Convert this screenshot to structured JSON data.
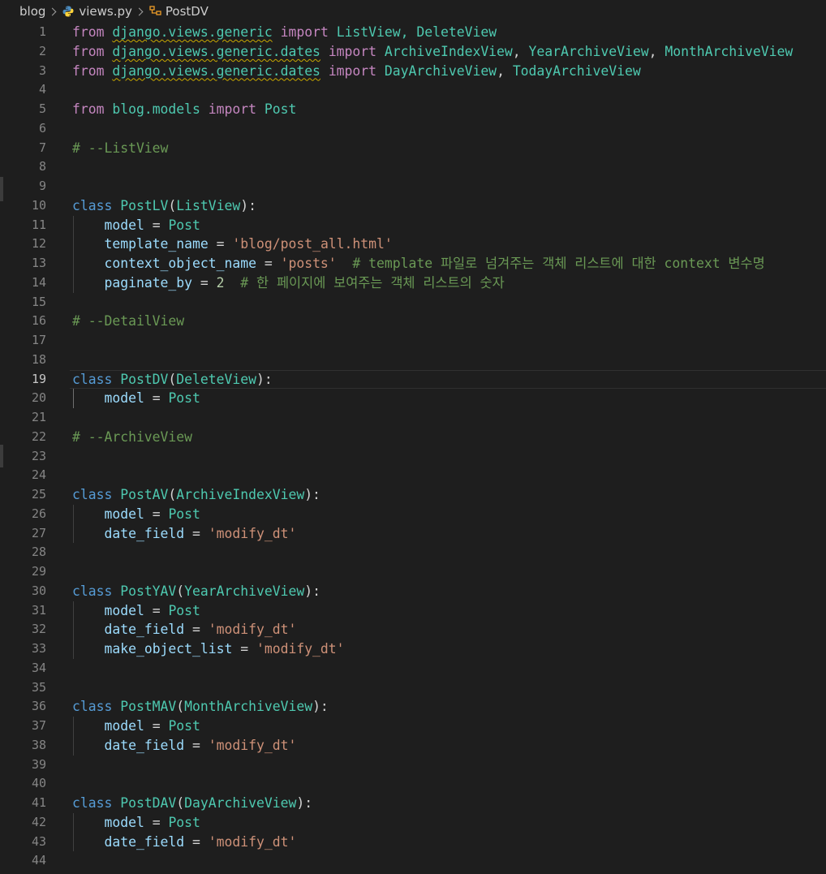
{
  "breadcrumb": {
    "items": [
      {
        "label": "blog",
        "icon": "folder"
      },
      {
        "label": "views.py",
        "icon": "python-icon"
      },
      {
        "label": "PostDV",
        "icon": "class-symbol-icon"
      }
    ]
  },
  "colors": {
    "background": "#1e1e1e",
    "keyword": "#c586c0",
    "storage": "#569cd6",
    "class": "#4ec9b0",
    "variable": "#9cdcfe",
    "string": "#ce9178",
    "number": "#b5cea8",
    "comment": "#6a9955",
    "warning_squiggle": "#c8a800"
  },
  "editor": {
    "current_line": 19,
    "lines": [
      {
        "n": "1",
        "guide": false,
        "tokens": [
          {
            "t": "from",
            "c": "keyword"
          },
          {
            "t": " ",
            "c": "default"
          },
          {
            "t": "django.views.generic",
            "c": "module",
            "w": true
          },
          {
            "t": " ",
            "c": "default"
          },
          {
            "t": "import",
            "c": "keyword"
          },
          {
            "t": " ListView, DeleteView",
            "c": "class"
          }
        ]
      },
      {
        "n": "2",
        "guide": false,
        "tokens": [
          {
            "t": "from",
            "c": "keyword"
          },
          {
            "t": " ",
            "c": "default"
          },
          {
            "t": "django.views.generic.dates",
            "c": "module",
            "w": true
          },
          {
            "t": " ",
            "c": "default"
          },
          {
            "t": "import",
            "c": "keyword"
          },
          {
            "t": " ArchiveIndexView",
            "c": "class"
          },
          {
            "t": ", ",
            "c": "default"
          },
          {
            "t": "YearArchiveView",
            "c": "class"
          },
          {
            "t": ", ",
            "c": "default"
          },
          {
            "t": "MonthArchiveView",
            "c": "class"
          }
        ]
      },
      {
        "n": "3",
        "guide": false,
        "tokens": [
          {
            "t": "from",
            "c": "keyword"
          },
          {
            "t": " ",
            "c": "default"
          },
          {
            "t": "django.views.generic.dates",
            "c": "module",
            "w": true
          },
          {
            "t": " ",
            "c": "default"
          },
          {
            "t": "import",
            "c": "keyword"
          },
          {
            "t": " DayArchiveView",
            "c": "class"
          },
          {
            "t": ", ",
            "c": "default"
          },
          {
            "t": "TodayArchiveView",
            "c": "class"
          }
        ]
      },
      {
        "n": "4",
        "guide": false,
        "tokens": []
      },
      {
        "n": "5",
        "guide": false,
        "tokens": [
          {
            "t": "from",
            "c": "keyword"
          },
          {
            "t": " blog.models ",
            "c": "module"
          },
          {
            "t": "import",
            "c": "keyword"
          },
          {
            "t": " Post",
            "c": "class"
          }
        ]
      },
      {
        "n": "6",
        "guide": false,
        "tokens": []
      },
      {
        "n": "7",
        "guide": false,
        "tokens": [
          {
            "t": "# --ListView",
            "c": "comment"
          }
        ]
      },
      {
        "n": "8",
        "guide": false,
        "tokens": []
      },
      {
        "n": "9",
        "guide": false,
        "tokens": []
      },
      {
        "n": "10",
        "guide": false,
        "tokens": [
          {
            "t": "class",
            "c": "storage"
          },
          {
            "t": " PostLV",
            "c": "class"
          },
          {
            "t": "(",
            "c": "default"
          },
          {
            "t": "ListView",
            "c": "class"
          },
          {
            "t": "):",
            "c": "default"
          }
        ]
      },
      {
        "n": "11",
        "guide": true,
        "tokens": [
          {
            "t": "    ",
            "c": "default"
          },
          {
            "t": "model",
            "c": "var"
          },
          {
            "t": " = ",
            "c": "op"
          },
          {
            "t": "Post",
            "c": "class"
          }
        ]
      },
      {
        "n": "12",
        "guide": true,
        "tokens": [
          {
            "t": "    ",
            "c": "default"
          },
          {
            "t": "template_name",
            "c": "var"
          },
          {
            "t": " = ",
            "c": "op"
          },
          {
            "t": "'blog/post_all.html'",
            "c": "string"
          }
        ]
      },
      {
        "n": "13",
        "guide": true,
        "tokens": [
          {
            "t": "    ",
            "c": "default"
          },
          {
            "t": "context_object_name",
            "c": "var"
          },
          {
            "t": " = ",
            "c": "op"
          },
          {
            "t": "'posts'",
            "c": "string"
          },
          {
            "t": "  # template 파일로 넘겨주는 객체 리스트에 대한 context 변수명",
            "c": "comment"
          }
        ]
      },
      {
        "n": "14",
        "guide": true,
        "tokens": [
          {
            "t": "    ",
            "c": "default"
          },
          {
            "t": "paginate_by",
            "c": "var"
          },
          {
            "t": " = ",
            "c": "op"
          },
          {
            "t": "2",
            "c": "number"
          },
          {
            "t": "  # 한 페이지에 보여주는 객체 리스트의 숫자",
            "c": "comment"
          }
        ]
      },
      {
        "n": "15",
        "guide": false,
        "tokens": []
      },
      {
        "n": "16",
        "guide": false,
        "tokens": [
          {
            "t": "# --DetailView",
            "c": "comment"
          }
        ]
      },
      {
        "n": "17",
        "guide": false,
        "tokens": []
      },
      {
        "n": "18",
        "guide": false,
        "tokens": []
      },
      {
        "n": "19",
        "guide": false,
        "tokens": [
          {
            "t": "class",
            "c": "storage"
          },
          {
            "t": " PostDV",
            "c": "class"
          },
          {
            "t": "(",
            "c": "default"
          },
          {
            "t": "DeleteView",
            "c": "class"
          },
          {
            "t": "):",
            "c": "default"
          }
        ]
      },
      {
        "n": "20",
        "guide": true,
        "active": true,
        "tokens": [
          {
            "t": "    ",
            "c": "default"
          },
          {
            "t": "model",
            "c": "var"
          },
          {
            "t": " = ",
            "c": "op"
          },
          {
            "t": "Post",
            "c": "class"
          }
        ]
      },
      {
        "n": "21",
        "guide": false,
        "tokens": []
      },
      {
        "n": "22",
        "guide": false,
        "tokens": [
          {
            "t": "# --ArchiveView",
            "c": "comment"
          }
        ]
      },
      {
        "n": "23",
        "guide": false,
        "tokens": []
      },
      {
        "n": "24",
        "guide": false,
        "tokens": []
      },
      {
        "n": "25",
        "guide": false,
        "tokens": [
          {
            "t": "class",
            "c": "storage"
          },
          {
            "t": " PostAV",
            "c": "class"
          },
          {
            "t": "(",
            "c": "default"
          },
          {
            "t": "ArchiveIndexView",
            "c": "class"
          },
          {
            "t": "):",
            "c": "default"
          }
        ]
      },
      {
        "n": "26",
        "guide": true,
        "tokens": [
          {
            "t": "    ",
            "c": "default"
          },
          {
            "t": "model",
            "c": "var"
          },
          {
            "t": " = ",
            "c": "op"
          },
          {
            "t": "Post",
            "c": "class"
          }
        ]
      },
      {
        "n": "27",
        "guide": true,
        "tokens": [
          {
            "t": "    ",
            "c": "default"
          },
          {
            "t": "date_field",
            "c": "var"
          },
          {
            "t": " = ",
            "c": "op"
          },
          {
            "t": "'modify_dt'",
            "c": "string"
          }
        ]
      },
      {
        "n": "28",
        "guide": false,
        "tokens": []
      },
      {
        "n": "29",
        "guide": false,
        "tokens": []
      },
      {
        "n": "30",
        "guide": false,
        "tokens": [
          {
            "t": "class",
            "c": "storage"
          },
          {
            "t": " PostYAV",
            "c": "class"
          },
          {
            "t": "(",
            "c": "default"
          },
          {
            "t": "YearArchiveView",
            "c": "class"
          },
          {
            "t": "):",
            "c": "default"
          }
        ]
      },
      {
        "n": "31",
        "guide": true,
        "tokens": [
          {
            "t": "    ",
            "c": "default"
          },
          {
            "t": "model",
            "c": "var"
          },
          {
            "t": " = ",
            "c": "op"
          },
          {
            "t": "Post",
            "c": "class"
          }
        ]
      },
      {
        "n": "32",
        "guide": true,
        "tokens": [
          {
            "t": "    ",
            "c": "default"
          },
          {
            "t": "date_field",
            "c": "var"
          },
          {
            "t": " = ",
            "c": "op"
          },
          {
            "t": "'modify_dt'",
            "c": "string"
          }
        ]
      },
      {
        "n": "33",
        "guide": true,
        "tokens": [
          {
            "t": "    ",
            "c": "default"
          },
          {
            "t": "make_object_list",
            "c": "var"
          },
          {
            "t": " = ",
            "c": "op"
          },
          {
            "t": "'modify_dt'",
            "c": "string"
          }
        ]
      },
      {
        "n": "34",
        "guide": false,
        "tokens": []
      },
      {
        "n": "35",
        "guide": false,
        "tokens": []
      },
      {
        "n": "36",
        "guide": false,
        "tokens": [
          {
            "t": "class",
            "c": "storage"
          },
          {
            "t": " PostMAV",
            "c": "class"
          },
          {
            "t": "(",
            "c": "default"
          },
          {
            "t": "MonthArchiveView",
            "c": "class"
          },
          {
            "t": "):",
            "c": "default"
          }
        ]
      },
      {
        "n": "37",
        "guide": true,
        "tokens": [
          {
            "t": "    ",
            "c": "default"
          },
          {
            "t": "model",
            "c": "var"
          },
          {
            "t": " = ",
            "c": "op"
          },
          {
            "t": "Post",
            "c": "class"
          }
        ]
      },
      {
        "n": "38",
        "guide": true,
        "tokens": [
          {
            "t": "    ",
            "c": "default"
          },
          {
            "t": "date_field",
            "c": "var"
          },
          {
            "t": " = ",
            "c": "op"
          },
          {
            "t": "'modify_dt'",
            "c": "string"
          }
        ]
      },
      {
        "n": "39",
        "guide": false,
        "tokens": []
      },
      {
        "n": "40",
        "guide": false,
        "tokens": []
      },
      {
        "n": "41",
        "guide": false,
        "tokens": [
          {
            "t": "class",
            "c": "storage"
          },
          {
            "t": " PostDAV",
            "c": "class"
          },
          {
            "t": "(",
            "c": "default"
          },
          {
            "t": "DayArchiveView",
            "c": "class"
          },
          {
            "t": "):",
            "c": "default"
          }
        ]
      },
      {
        "n": "42",
        "guide": true,
        "tokens": [
          {
            "t": "    ",
            "c": "default"
          },
          {
            "t": "model",
            "c": "var"
          },
          {
            "t": " = ",
            "c": "op"
          },
          {
            "t": "Post",
            "c": "class"
          }
        ]
      },
      {
        "n": "43",
        "guide": true,
        "tokens": [
          {
            "t": "    ",
            "c": "default"
          },
          {
            "t": "date_field",
            "c": "var"
          },
          {
            "t": " = ",
            "c": "op"
          },
          {
            "t": "'modify_dt'",
            "c": "string"
          }
        ]
      },
      {
        "n": "44",
        "guide": false,
        "tokens": []
      }
    ]
  }
}
